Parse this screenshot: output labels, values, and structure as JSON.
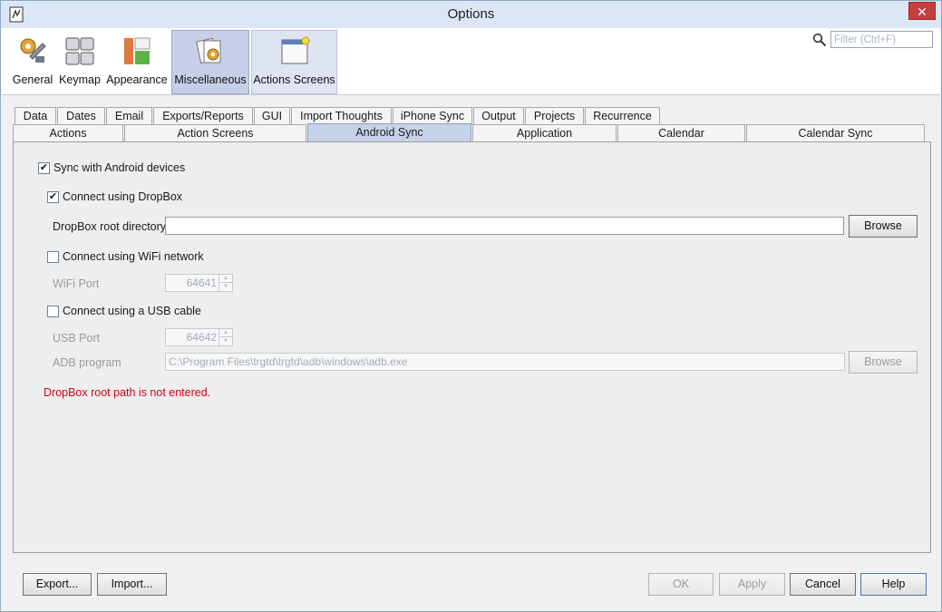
{
  "window": {
    "title": "Options",
    "close_glyph": "✕"
  },
  "toolbar": {
    "buttons": [
      {
        "label": "General",
        "icon": "gears-wrench-icon"
      },
      {
        "label": "Keymap",
        "icon": "keyboard-keys-icon"
      },
      {
        "label": "Appearance",
        "icon": "layout-panels-icon"
      },
      {
        "label": "Miscellaneous",
        "icon": "misc-documents-icon"
      },
      {
        "label": "Actions Screens",
        "icon": "window-screen-icon"
      }
    ],
    "selected": "Miscellaneous",
    "search_placeholder": "Filter (Ctrl+F)"
  },
  "tabs_row1": [
    "Data",
    "Dates",
    "Email",
    "Exports/Reports",
    "GUI",
    "Import Thoughts",
    "iPhone Sync",
    "Output",
    "Projects",
    "Recurrence"
  ],
  "tabs_row2": [
    "Actions",
    "Action Screens",
    "Android Sync",
    "Application",
    "Calendar",
    "Calendar Sync"
  ],
  "active_tab": "Android Sync",
  "form": {
    "sync_android": {
      "label": "Sync with Android devices",
      "checked": true
    },
    "dropbox": {
      "label": "Connect using DropBox",
      "checked": true
    },
    "dropbox_root_label": "DropBox root directory",
    "dropbox_root_value": "",
    "browse_label": "Browse",
    "wifi": {
      "label": "Connect using WiFi network",
      "checked": false
    },
    "wifi_port_label": "WiFi Port",
    "wifi_port_value": "64641",
    "usb": {
      "label": "Connect using a USB cable",
      "checked": false
    },
    "usb_port_label": "USB Port",
    "usb_port_value": "64642",
    "adb_label": "ADB program",
    "adb_value": "C:\\Program Files\\trgtd\\trgtd\\adb\\windows\\adb.exe",
    "adb_browse_label": "Browse",
    "error": "DropBox root path is not entered."
  },
  "footer": {
    "export_label": "Export...",
    "import_label": "Import...",
    "ok_label": "OK",
    "apply_label": "Apply",
    "cancel_label": "Cancel",
    "help_label": "Help"
  },
  "colors": {
    "error": "#d0021b",
    "selected_toolbar": "#c7cee7",
    "active_tab": "#c5d3e8"
  }
}
